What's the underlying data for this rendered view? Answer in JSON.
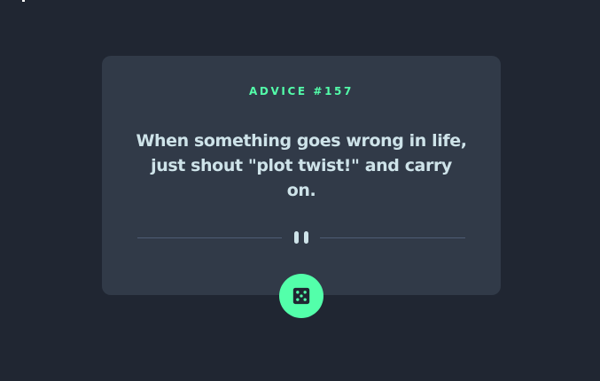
{
  "advice": {
    "heading": "ADVICE #157",
    "text": "When something goes wrong in life, just shout \"plot twist!\" and carry on."
  },
  "divider": {
    "icon": "pause-icon"
  },
  "generate_button": {
    "icon": "dice-icon"
  },
  "colors": {
    "background": "#202632",
    "card": "#313a48",
    "accent": "#53ffaa",
    "text": "#cee3e9",
    "divider": "#4f5d74"
  }
}
